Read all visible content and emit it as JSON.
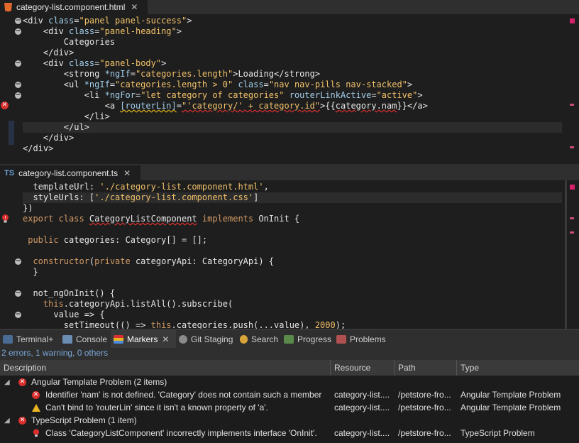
{
  "editor_html": {
    "tab": {
      "icon": "html5-icon",
      "title": "category-list.component.html",
      "close": "✕"
    },
    "lines": [
      {
        "text": "<div class=\"panel panel-success\">"
      },
      {
        "text": "    <div class=\"panel-heading\">"
      },
      {
        "text": "        Categories"
      },
      {
        "text": "    </div>"
      },
      {
        "text": "    <div class=\"panel-body\">"
      },
      {
        "text": "        <strong *ngIf=\"categories.length\">Loading</strong>"
      },
      {
        "text": "        <ul *ngIf=\"categories.length > 0\" class=\"nav nav-pills nav-stacked\">"
      },
      {
        "text": "            <li *ngFor=\"let category of categories\" routerLinkActive=\"active\">"
      },
      {
        "text": "                <a [routerLin]=\"'category/' + category.id\">{{category.nam}}</a>"
      },
      {
        "text": "            </li>"
      },
      {
        "text": "        </ul>"
      },
      {
        "text": "    </div>"
      },
      {
        "text": "</div>"
      }
    ]
  },
  "editor_ts": {
    "tab": {
      "icon": "TS",
      "title": "category-list.component.ts",
      "close": "✕"
    },
    "lines": [
      {
        "text": "  templateUrl: './category-list.component.html',"
      },
      {
        "text": "  styleUrls: ['./category-list.component.css']"
      },
      {
        "text": "})"
      },
      {
        "text": "export class CategoryListComponent implements OnInit {"
      },
      {
        "text": ""
      },
      {
        "text": " public categories: Category[] = [];"
      },
      {
        "text": ""
      },
      {
        "text": "  constructor(private categoryApi: CategoryApi) {"
      },
      {
        "text": "  }"
      },
      {
        "text": ""
      },
      {
        "text": "  not_ngOnInit() {"
      },
      {
        "text": "    this.categoryApi.listAll().subscribe("
      },
      {
        "text": "      value => {"
      },
      {
        "text": "        setTimeout(() => this.categories.push(...value), 2000);"
      }
    ]
  },
  "views": {
    "tabs": [
      {
        "label": "Terminal+",
        "icon": "terminal-icon"
      },
      {
        "label": "Console",
        "icon": "console-icon"
      },
      {
        "label": "Markers",
        "icon": "markers-icon",
        "active": true,
        "close": "✕"
      },
      {
        "label": "Git Staging",
        "icon": "git-icon"
      },
      {
        "label": "Search",
        "icon": "search-icon"
      },
      {
        "label": "Progress",
        "icon": "progress-icon"
      },
      {
        "label": "Problems",
        "icon": "problems-icon"
      }
    ],
    "summary": "2 errors, 1 warning, 0 others"
  },
  "markers": {
    "columns": [
      "Description",
      "Resource",
      "Path",
      "Type"
    ],
    "groups": [
      {
        "label": "Angular Template Problem (2 items)",
        "items": [
          {
            "severity": "error",
            "description": "Identifier 'nam' is not defined. 'Category' does not contain such a member",
            "resource": "category-list....",
            "path": "/petstore-fro...",
            "type": "Angular Template Problem"
          },
          {
            "severity": "warning",
            "description": "Can't bind to 'routerLin' since it isn't a known property of 'a'.",
            "resource": "category-list....",
            "path": "/petstore-fro...",
            "type": "Angular Template Problem"
          }
        ]
      },
      {
        "label": "TypeScript Problem (1 item)",
        "items": [
          {
            "severity": "error-bulb",
            "description": "Class 'CategoryListComponent' incorrectly implements interface 'OnInit'.",
            "resource": "category-list....",
            "path": "/petstore-fro...",
            "type": "TypeScript Problem"
          }
        ]
      }
    ]
  },
  "colors": {
    "error": "#d9302f",
    "warning": "#e9b422",
    "string": "#f2c26a",
    "attr": "#a2cdea",
    "keyword": "#d19a66"
  }
}
